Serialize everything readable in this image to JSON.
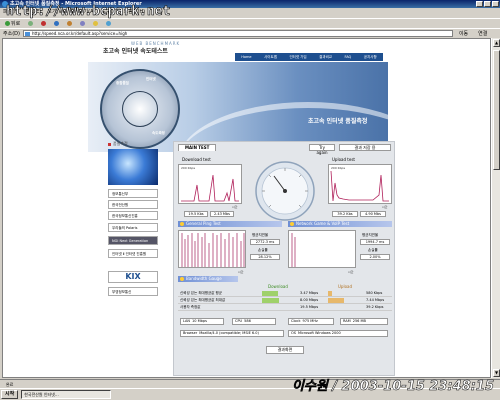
{
  "window": {
    "title": "초고속 인터넷 품질측정 - Microsoft Internet Explorer"
  },
  "watermark": "http://www.bcpark.net",
  "menu": [
    "파일(F)",
    "편집(E)",
    "보기(V)",
    "즐겨찾기(A)",
    "도구(T)",
    "도움말(H)"
  ],
  "toolbar": {
    "back": "뒤로",
    "forward": "",
    "stop": "",
    "refresh": "",
    "home": "",
    "search": "",
    "favorites": "",
    "media": ""
  },
  "address": {
    "label": "주소(D)",
    "url": "http://speed.nca.or.kr/default.asp?service=high",
    "go": "이동",
    "links": "연결"
  },
  "page": {
    "brand_small": "WEB BENCHMARK",
    "brand_title": "초고속 인터넷 속도테스트",
    "nav": [
      "Home",
      "사이트맵",
      "인터넷 가입",
      "결과비교",
      "FAQ",
      "공지사항"
    ],
    "banner_title": "초고속 인터넷 품질측정",
    "dial_labels": [
      "종합품질",
      "인터넷",
      "속도측정"
    ],
    "sidebar_title": "품질측정",
    "sidebar_items": [
      "정보통신부",
      "한국전산원",
      "한국정보통신진흥",
      "우리들의 Polaris",
      "NGI Next Generation",
      "인터넷 Ⅱ 인터넷 진흥원"
    ],
    "kix": "KIX",
    "sidebar_last": "부영정보통신"
  },
  "panel": {
    "tab": "MAIN TEST",
    "try_again": "Try again",
    "save_result": "결과 저장 용",
    "download_test": "Download test",
    "upload_test": "Upload test",
    "dl_scale": "200 Kbps",
    "ul_scale": "200 Kbps",
    "time_label": "시간",
    "dl_time": "19.5 Kbs",
    "dl_speed": "2.43 Mbs",
    "ul_time": "39.2 Kbs",
    "ul_speed": "4.90 Mbs",
    "ping_bar": "General Ping Test",
    "game_bar": "Network Game & VoIP Test",
    "ping_avg_label": "평균지연율",
    "ping_avg": "2772.3 ms",
    "ping_loss_label": "손실률",
    "ping_loss": "28.12%",
    "game_avg_label": "평균지연율",
    "game_avg": "1994.7 ms",
    "game_loss_label": "손실률",
    "game_loss": "2.00%",
    "bw_bar": "Bandwidth Gauge",
    "legend_dl": "Download",
    "legend_ul": "Upload",
    "rows": [
      {
        "label": "신뢰성 있는 최대평균값 평균",
        "dl": "3.47 Mbps",
        "ul": "580 Kbps",
        "dl_pct": 0.45,
        "ul_pct": 0.1
      },
      {
        "label": "신뢰성 있는 최대평균값 최대값",
        "dl": "8.00 Mbps",
        "ul": "7.44 Mbps",
        "dl_pct": 0.48,
        "ul_pct": 0.45
      },
      {
        "label": "사용자 측정값",
        "dl": "19.5 Mbps",
        "ul": "39.2 Kbps",
        "dl_pct": 0,
        "ul_pct": 0
      }
    ],
    "lan_label": "LAN",
    "lan": "10 Mbps",
    "cpu_label": "CPU",
    "cpu": "586",
    "clock_label": "Clock",
    "clock": "975 MHz",
    "ram_label": "RAM",
    "ram": "256 MB",
    "browser_label": "Browser",
    "browser": "Mozilla/4.0 (compatible; MSIE 6.0)",
    "os_label": "OS",
    "os": "Microsoft Windows 2000",
    "result_btn": "결과화면"
  },
  "status": {
    "text": "완료"
  },
  "taskbar": {
    "start": "시작",
    "task1": "한국전산원 인터넷..."
  },
  "datestamp": "이수원 / 2003-10-15 23:48:15"
}
